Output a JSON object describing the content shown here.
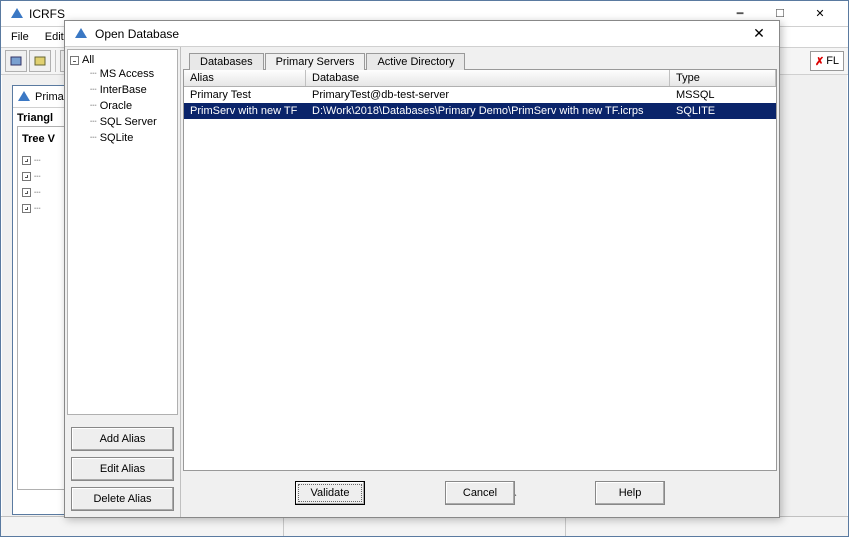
{
  "main": {
    "title": "ICRFS",
    "menu": [
      "File",
      "Edit"
    ],
    "fl_label": "FL"
  },
  "sub": {
    "title": "Prima",
    "label": "Triangl",
    "tree_label": "Tree V"
  },
  "dialog": {
    "title": "Open Database",
    "tree": {
      "root": "All",
      "children": [
        "MS Access",
        "InterBase",
        "Oracle",
        "SQL Server",
        "SQLite"
      ]
    },
    "side_buttons": {
      "add": "Add Alias",
      "edit": "Edit Alias",
      "delete": "Delete Alias"
    },
    "tabs": [
      "Databases",
      "Primary Servers",
      "Active Directory"
    ],
    "active_tab": 1,
    "grid": {
      "headers": {
        "alias": "Alias",
        "database": "Database",
        "type": "Type"
      },
      "rows": [
        {
          "alias": "Primary Test",
          "database": "PrimaryTest@db-test-server",
          "type": "MSSQL",
          "selected": false
        },
        {
          "alias": "PrimServ with new TF",
          "database": "D:\\Work\\2018\\Databases\\Primary Demo\\PrimServ with new TF.icrps",
          "type": "SQLITE",
          "selected": true
        }
      ]
    },
    "bottom_buttons": {
      "validate": "Validate",
      "cancel": "Cancel",
      "help": "Help"
    }
  }
}
